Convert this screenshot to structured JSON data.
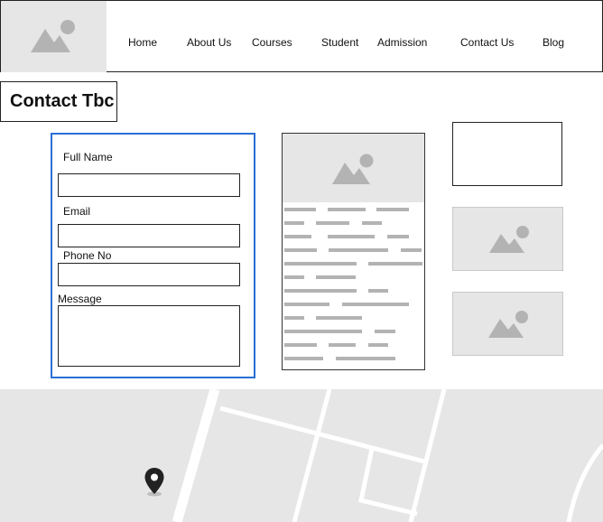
{
  "nav": {
    "items": [
      "Home",
      "About Us",
      "Courses",
      "Student",
      "Admission",
      "Contact Us",
      "Blog"
    ]
  },
  "page": {
    "title": "Contact Tbc"
  },
  "form": {
    "full_name_label": "Full Name",
    "email_label": "Email",
    "phone_label": "Phone No",
    "message_label": "Message"
  },
  "icons": {
    "logo": "image-placeholder-icon",
    "article_image": "image-placeholder-icon",
    "side_image": "image-placeholder-icon",
    "map_pin": "map-pin-icon"
  },
  "colors": {
    "accent": "#2a6fd6",
    "placeholder_fill": "#e6e6e6",
    "placeholder_icon": "#b3b3b3",
    "text_line": "#b3b3b3"
  }
}
